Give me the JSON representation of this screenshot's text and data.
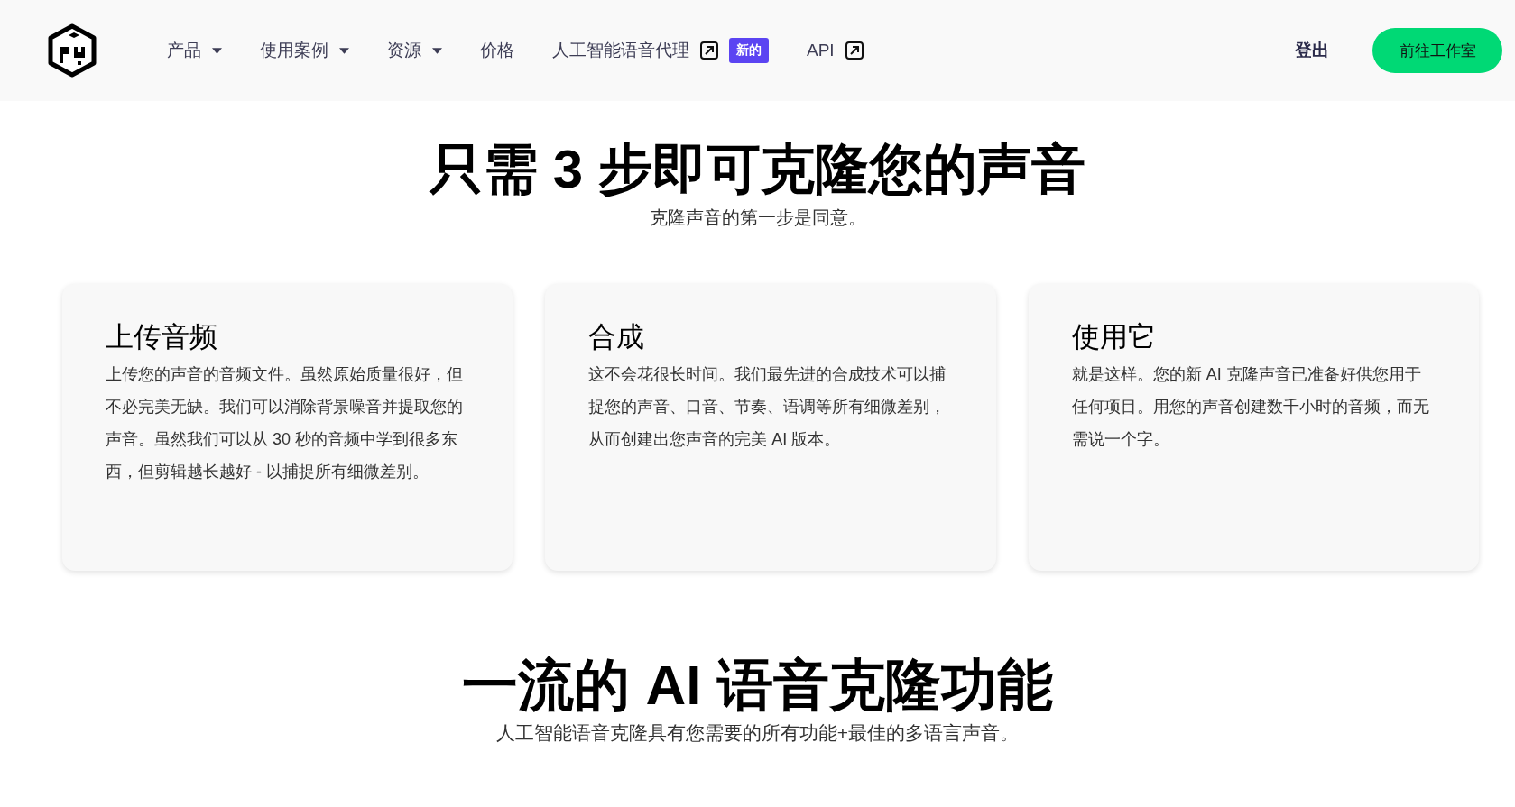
{
  "nav": {
    "items": [
      {
        "label": "产品",
        "kind": "dropdown"
      },
      {
        "label": "使用案例",
        "kind": "dropdown"
      },
      {
        "label": "资源",
        "kind": "dropdown"
      },
      {
        "label": "价格",
        "kind": "plain"
      },
      {
        "label": "人工智能语音代理",
        "kind": "external",
        "badge": "新的"
      },
      {
        "label": "API",
        "kind": "external"
      }
    ],
    "login": "登出",
    "cta": "前往工作室"
  },
  "steps": {
    "title": "只需 3 步即可克隆您的声音",
    "subtitle": "克隆声音的第一步是同意。",
    "cards": [
      {
        "title": "上传音频",
        "text": "上传您的声音的音频文件。虽然原始质量很好，但不必完美无缺。我们可以消除背景噪音并提取您的声音。虽然我们可以从 30 秒的音频中学到很多东西，但剪辑越长越好 - 以捕捉所有细微差别。"
      },
      {
        "title": "合成",
        "text": "这不会花很长时间。我们最先进的合成技术可以捕捉您的声音、口音、节奏、语调等所有细微差别，从而创建出您声音的完美 AI 版本。"
      },
      {
        "title": "使用它",
        "text": "就是这样。您的新 AI 克隆声音已准备好供您用于任何项目。用您的声音创建数千小时的音频，而无需说一个字。"
      }
    ]
  },
  "features": {
    "title": "一流的 AI 语音克隆功能",
    "subtitle": "人工智能语音克隆具有您需要的所有功能+最佳的多语言声音。"
  }
}
